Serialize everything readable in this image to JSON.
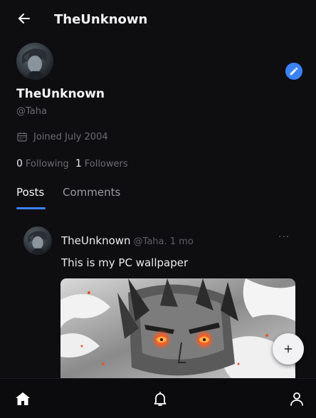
{
  "header": {
    "title": "TheUnknown",
    "back_icon": "arrow-left-icon"
  },
  "profile": {
    "name": "TheUnknown",
    "handle": "@Taha",
    "joined": "Joined July 2004",
    "following_count": "0",
    "following_label": "Following",
    "followers_count": "1",
    "followers_label": "Followers",
    "edit_icon": "pencil-icon",
    "accent": "#3b82f6"
  },
  "tabs": {
    "posts": "Posts",
    "comments": "Comments",
    "active": "Posts"
  },
  "post": {
    "author": "TheUnknown",
    "meta": "@Taha. 1 mo",
    "more": "···",
    "text": "This is my PC wallpaper"
  },
  "fab": {
    "icon": "plus-icon"
  },
  "bottom_nav": {
    "items": [
      "home-icon",
      "bell-icon",
      "profile-icon"
    ],
    "active": "home-icon"
  }
}
